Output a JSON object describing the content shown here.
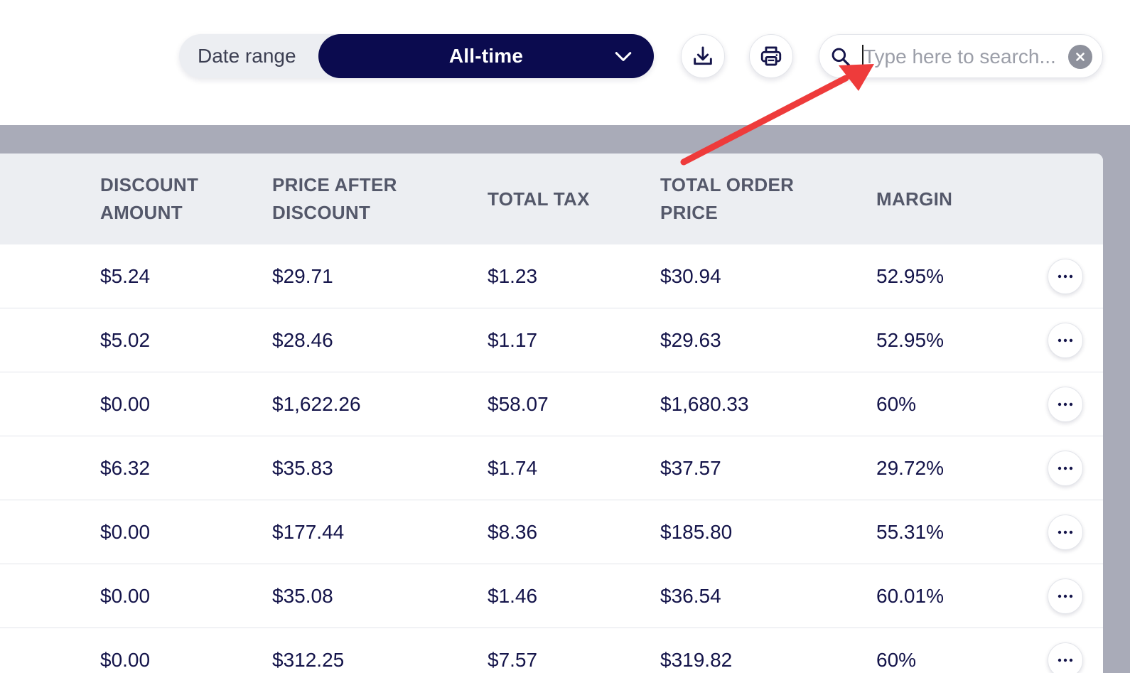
{
  "toolbar": {
    "date_range_label": "Date range",
    "date_range_value": "All-time",
    "download_icon": "download-icon",
    "print_icon": "printer-icon",
    "search": {
      "placeholder": "Type here to search...",
      "value": ""
    }
  },
  "table": {
    "headers": [
      {
        "line1": "DISCOUNT",
        "line2": "AMOUNT"
      },
      {
        "line1": "PRICE AFTER",
        "line2": "DISCOUNT"
      },
      {
        "line1": "TOTAL TAX",
        "line2": ""
      },
      {
        "line1": "TOTAL ORDER",
        "line2": "PRICE"
      },
      {
        "line1": "MARGIN",
        "line2": ""
      }
    ],
    "rows": [
      [
        "$5.24",
        "$29.71",
        "$1.23",
        "$30.94",
        "52.95%"
      ],
      [
        "$5.02",
        "$28.46",
        "$1.17",
        "$29.63",
        "52.95%"
      ],
      [
        "$0.00",
        "$1,622.26",
        "$58.07",
        "$1,680.33",
        "60%"
      ],
      [
        "$6.32",
        "$35.83",
        "$1.74",
        "$37.57",
        "29.72%"
      ],
      [
        "$0.00",
        "$177.44",
        "$8.36",
        "$185.80",
        "55.31%"
      ],
      [
        "$0.00",
        "$35.08",
        "$1.46",
        "$36.54",
        "60.01%"
      ],
      [
        "$0.00",
        "$312.25",
        "$7.57",
        "$319.82",
        "60%"
      ]
    ],
    "row_action_icon": "more-horizontal-icon"
  },
  "colors": {
    "navy": "#0b0b4f",
    "header_bg": "#eceef2",
    "backdrop": "#a9abb8",
    "annotation_arrow": "#ee3b3b"
  }
}
